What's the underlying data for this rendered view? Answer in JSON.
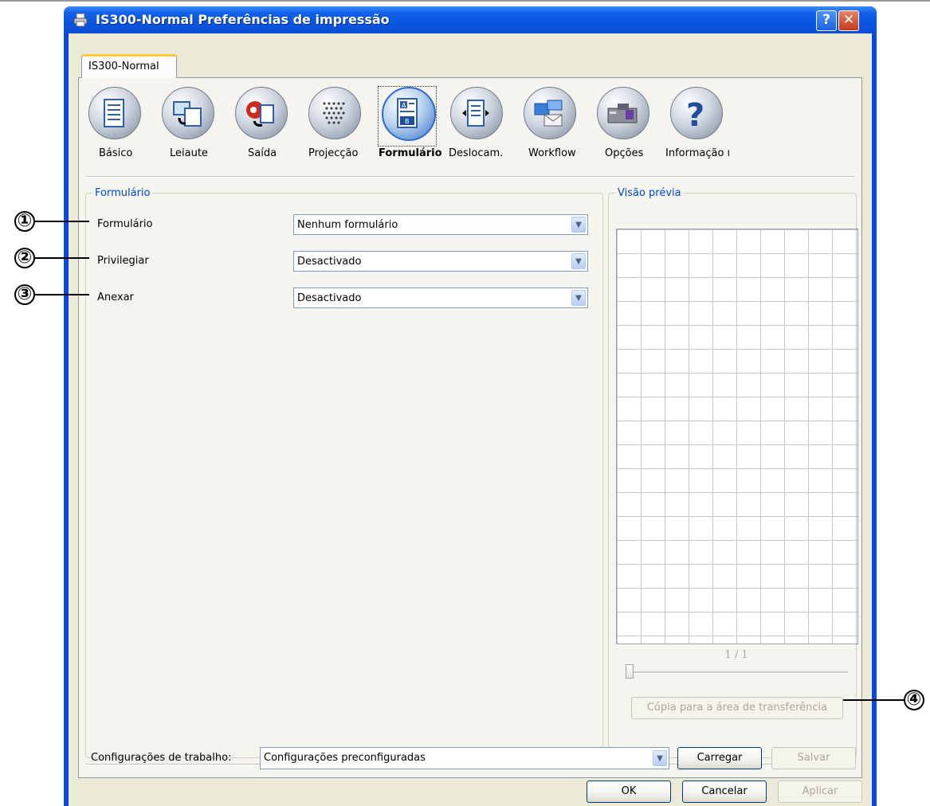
{
  "window": {
    "title": "IS300-Normal Preferências de impressão",
    "help_label": "?",
    "close_label": "✕"
  },
  "tab": {
    "label": "IS300-Normal"
  },
  "categories": [
    {
      "label": "Básico",
      "icon": "document-icon"
    },
    {
      "label": "Leiaute",
      "icon": "layout-icon"
    },
    {
      "label": "Saída",
      "icon": "output-icon"
    },
    {
      "label": "Projecção",
      "icon": "halftone-icon"
    },
    {
      "label": "Formulário",
      "icon": "form-icon",
      "selected": true
    },
    {
      "label": "Deslocam.",
      "icon": "shift-icon"
    },
    {
      "label": "Workflow",
      "icon": "workflow-icon"
    },
    {
      "label": "Opções",
      "icon": "options-icon"
    },
    {
      "label": "Informação ı",
      "icon": "help-icon"
    }
  ],
  "form_group": {
    "title": "Formulário",
    "fields": [
      {
        "label": "Formulário",
        "value": "Nenhum formulário"
      },
      {
        "label": "Privilegiar",
        "value": "Desactivado"
      },
      {
        "label": "Anexar",
        "value": "Desactivado"
      }
    ]
  },
  "preview_group": {
    "title": "Visão prévia",
    "page_indicator": "1 / 1",
    "copy_button": "Cópia para a área de transferência"
  },
  "job_settings": {
    "label": "Configurações de trabalho:",
    "value": "Configurações preconfiguradas",
    "load_button": "Carregar",
    "save_button": "Salvar"
  },
  "footer": {
    "ok": "OK",
    "cancel": "Cancelar",
    "apply": "Aplicar"
  },
  "callouts": [
    "①",
    "②",
    "③",
    "④"
  ],
  "colors": {
    "titlebar": "#0a55e0",
    "dialog_bg": "#ece9d8",
    "groupbox_title": "#0046d5",
    "tab_highlight": "#ffc83c"
  }
}
